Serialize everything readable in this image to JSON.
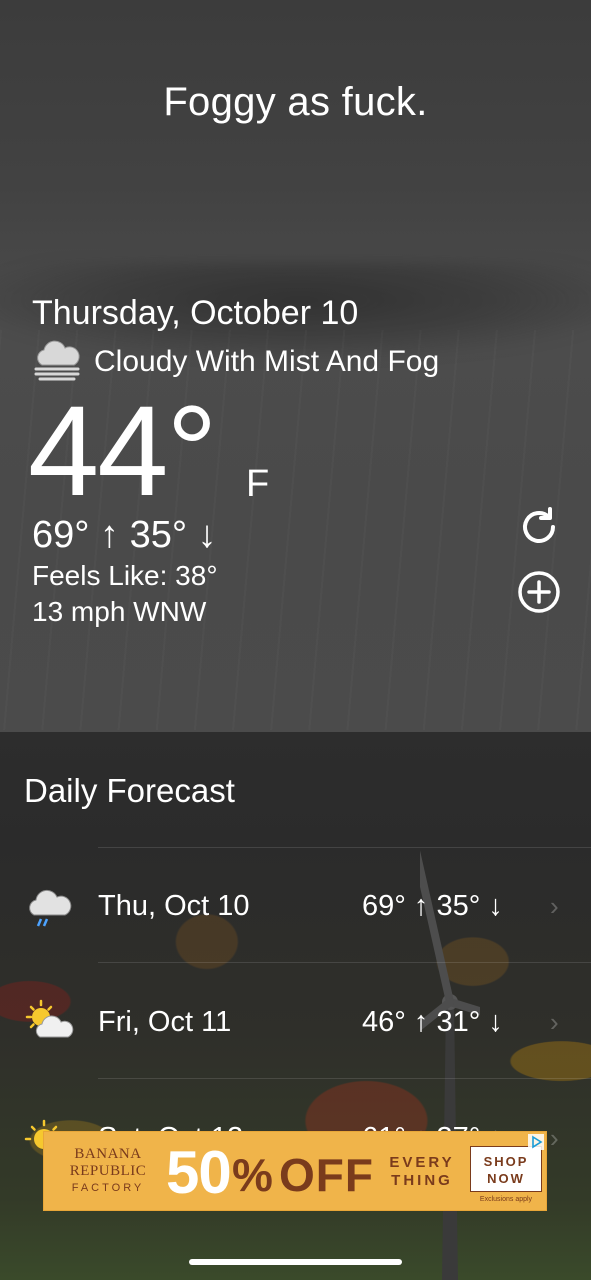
{
  "headline": "Foggy as fuck.",
  "current": {
    "date": "Thursday, October 10",
    "condition_icon": "fog-cloud-icon",
    "condition": "Cloudy With Mist And Fog",
    "temp": "44°",
    "unit": "F",
    "hi_lo": "69° ↑ 35° ↓",
    "feels_like": "Feels Like: 38°",
    "wind": "13 mph WNW"
  },
  "actions": {
    "refresh_icon": "refresh-icon",
    "add_icon": "add-location-icon"
  },
  "forecast": {
    "title": "Daily Forecast",
    "days": [
      {
        "icon": "rain-cloud-icon",
        "day": "Thu, Oct 10",
        "temps": "69° ↑  35° ↓"
      },
      {
        "icon": "partly-cloudy-icon",
        "day": "Fri, Oct 11",
        "temps": "46° ↑  31° ↓"
      },
      {
        "icon": "sunny-icon",
        "day": "Sat, Oct 12",
        "temps": "61° ↑  37° ↓"
      }
    ]
  },
  "ad": {
    "brand_line1": "BANANA",
    "brand_line2": "REPUBLIC",
    "brand_line3": "FACTORY",
    "discount": "50",
    "percent": "%",
    "off": "OFF",
    "every_line1": "EVERY",
    "every_line2": "THING",
    "cta_line1": "SHOP",
    "cta_line2": "NOW",
    "disclaimer": "Exclusions apply",
    "colors": {
      "background": "#f0b44a",
      "text": "#7a3b1c"
    }
  }
}
